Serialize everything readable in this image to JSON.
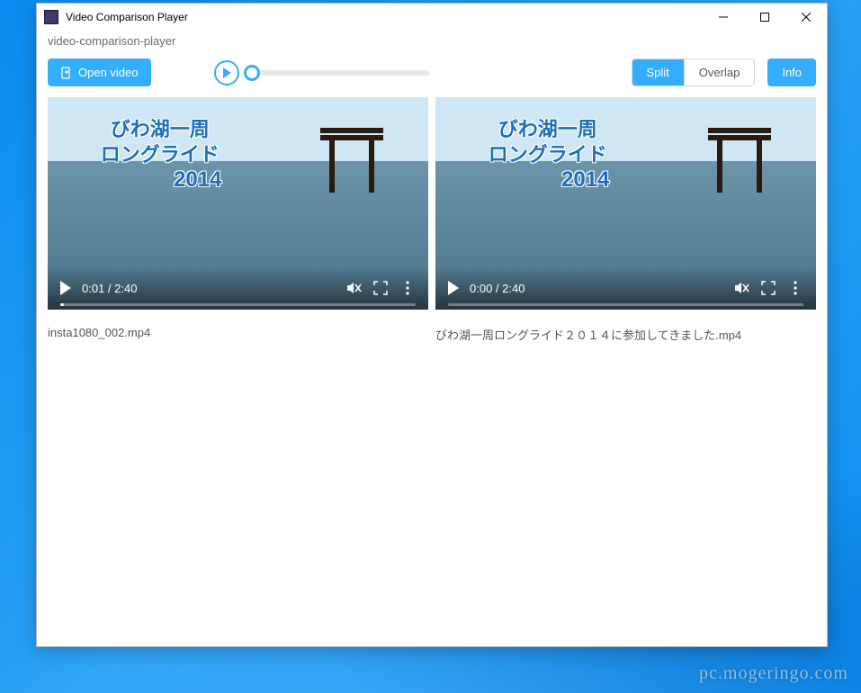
{
  "window": {
    "title": "Video Comparison Player",
    "subtitle": "video-comparison-player"
  },
  "toolbar": {
    "open_label": "Open video",
    "view_modes": {
      "split": "Split",
      "overlap": "Overlap"
    },
    "active_mode": "split",
    "info_label": "Info",
    "slider_value": 0
  },
  "videos": [
    {
      "overlay_line1": "びわ湖一周",
      "overlay_line2": "ロングライド",
      "overlay_year": "2014",
      "current_time": "0:01",
      "duration": "2:40",
      "progress_pct": 1,
      "filename": "insta1080_002.mp4"
    },
    {
      "overlay_line1": "びわ湖一周",
      "overlay_line2": "ロングライド",
      "overlay_year": "2014",
      "current_time": "0:00",
      "duration": "2:40",
      "progress_pct": 0,
      "filename": "びわ湖一周ロングライド２０１４に参加してきました.mp4"
    }
  ],
  "watermark": "pc.mogeringo.com"
}
